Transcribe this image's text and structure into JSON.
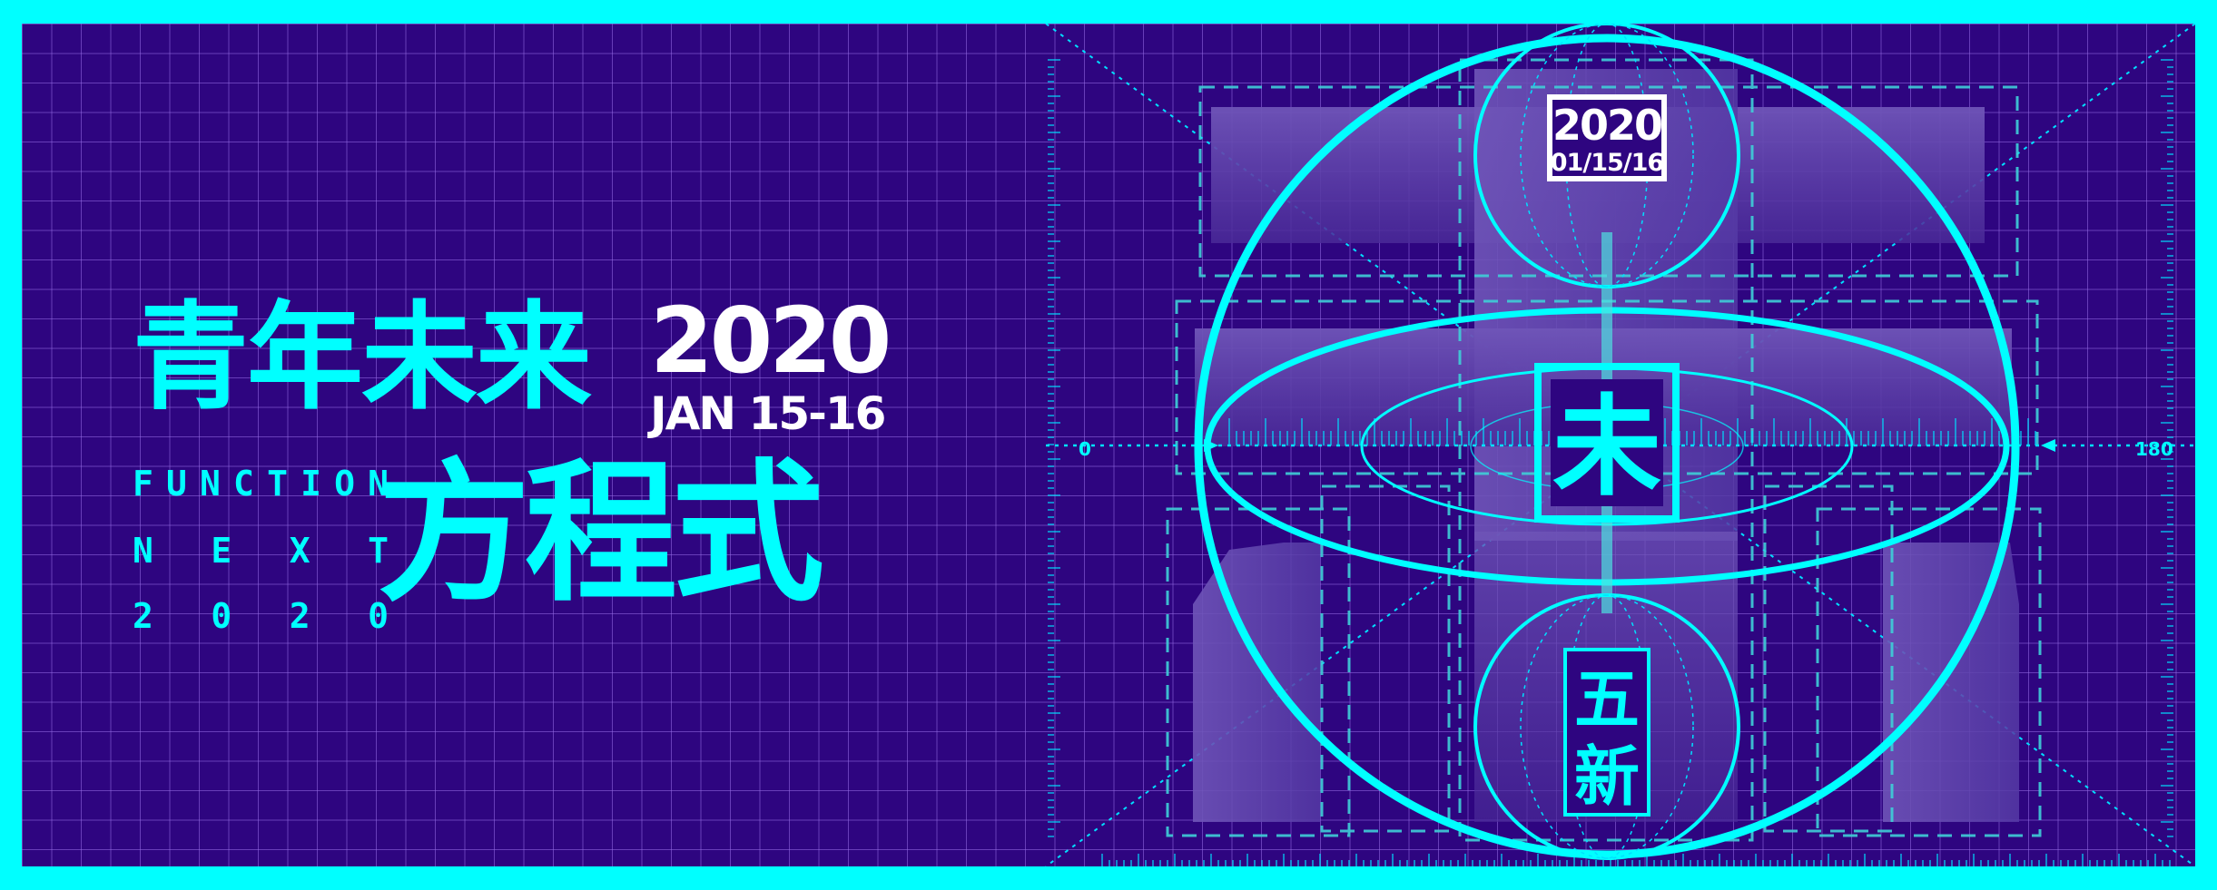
{
  "title": {
    "line1": "青年未来",
    "line2": "方程式"
  },
  "event": {
    "year": "2020",
    "dates": "JAN 15-16"
  },
  "subtitle": {
    "word1": [
      "F",
      "U",
      "N",
      "C",
      "T",
      "I",
      "O",
      "N"
    ],
    "word2": [
      "N",
      "E",
      "X",
      "T"
    ],
    "word3": [
      "2",
      "0",
      "2",
      "0"
    ]
  },
  "diagram": {
    "top_label_year": "2020",
    "top_label_date": "01/15/16",
    "center_char": "未",
    "bottom_char_1": "五",
    "bottom_char_2": "新",
    "scale_left": "0",
    "scale_right": "180"
  },
  "colors": {
    "frame": "#00ffff",
    "background": "#2e0580",
    "accent": "#00ffff",
    "text_white": "#ffffff",
    "block_fill": "#6b50b0"
  }
}
